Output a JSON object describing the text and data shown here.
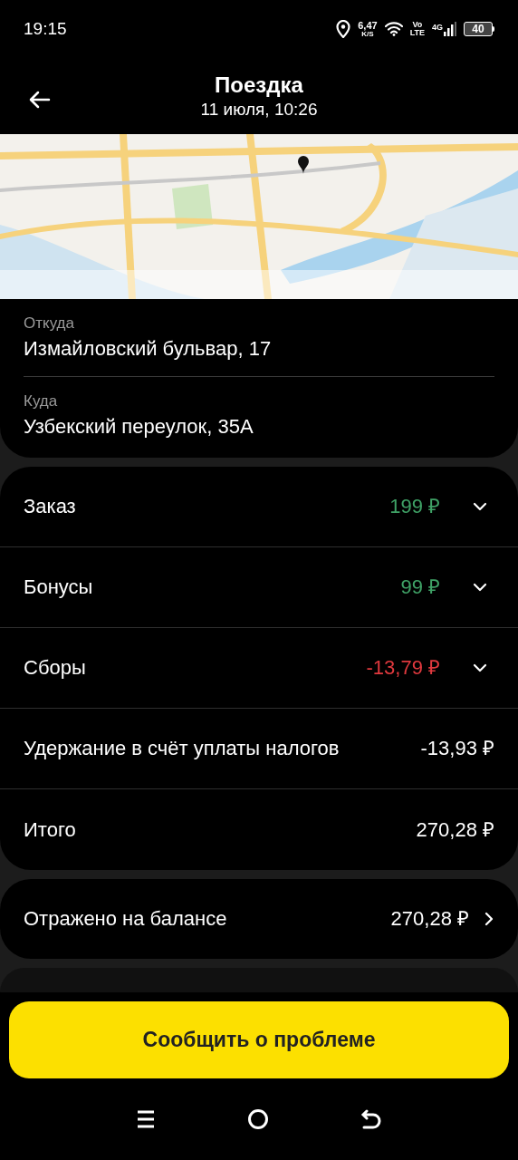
{
  "status_bar": {
    "time": "19:15",
    "speed": "6,47",
    "speed_unit": "K/S",
    "volte_top": "Vo",
    "volte_bottom": "LTE",
    "network": "4G",
    "battery": "40"
  },
  "header": {
    "title": "Поездка",
    "subtitle": "11 июля, 10:26"
  },
  "route": [
    {
      "label": "Откуда",
      "address": "Измайловский бульвар, 17"
    },
    {
      "label": "Куда",
      "address": "Узбекский переулок, 35А"
    }
  ],
  "breakdown": [
    {
      "kind": "expandable",
      "label": "Заказ",
      "amount": "199 ₽",
      "color": "#3fa266",
      "expanded": false
    },
    {
      "kind": "expandable",
      "label": "Бонусы",
      "amount": "99 ₽",
      "color": "#3fa266",
      "expanded": false
    },
    {
      "kind": "expandable",
      "label": "Сборы",
      "amount": "-13,79 ₽",
      "color": "#e0393e",
      "expanded": false
    },
    {
      "kind": "plain",
      "label": "Удержание в счёт уплаты налогов",
      "amount": "-13,93 ₽",
      "color": "#ffffff"
    },
    {
      "kind": "plain",
      "label": "Итого",
      "amount": "270,28 ₽",
      "color": "#ffffff"
    }
  ],
  "balance": {
    "label": "Отражено на балансе",
    "amount": "270,28 ₽"
  },
  "report_button": {
    "label": "Сообщить о проблеме"
  }
}
